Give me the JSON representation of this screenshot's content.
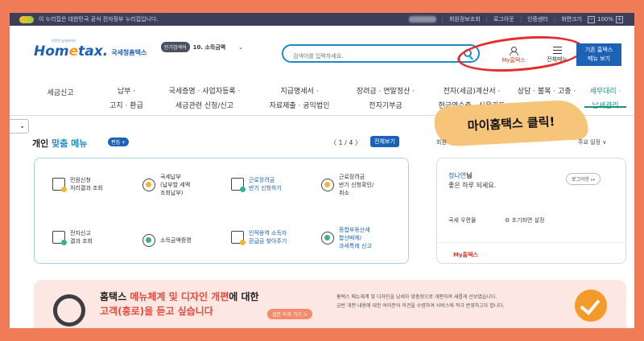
{
  "topbar": {
    "gov_notice": "이 누리집은 대한민국 공식 전자정부 누리집입니다.",
    "links": [
      "회원정보조회",
      "로그아웃",
      "인증센터",
      "화면크기"
    ],
    "zoom": "100%"
  },
  "header": {
    "logo_brand_a": "Hom",
    "logo_brand_b": "e",
    "logo_brand_c": "tax.",
    "logo_agency": "국세청홈택스",
    "logo_tag": "안전한 납세서비스",
    "popular_badge": "인기검색어",
    "popular_item": "10. 소득금액",
    "search_placeholder": "검색어를 입력하세요.",
    "my_hometax": "My홈택스",
    "all_menu": "전체메뉴",
    "site_menu_line1": "기존 홈택스",
    "site_menu_line2": "메뉴 보기"
  },
  "gnb": [
    {
      "l1": "세금신고",
      "l2": ""
    },
    {
      "l1": "납부 ·",
      "l2": "고지 · 환급"
    },
    {
      "l1": "국세증명 · 사업자등록 ·",
      "l2": "세금관련 신청/신고"
    },
    {
      "l1": "지급명세서 ·",
      "l2": "자료제출 · 공익법인"
    },
    {
      "l1": "장려금 · 연말정산 ·",
      "l2": "전자기부금"
    },
    {
      "l1": "전자(세금)계산서 ·",
      "l2": "현금영수증 · 신용카드"
    },
    {
      "l1": "상담 · 불복 · 고충 ·",
      "l2": "제보 · 기타"
    },
    {
      "l1": "세무대리 ·",
      "l2": "납세관리"
    }
  ],
  "callout": "마이홈택스 클릭!",
  "quick": {
    "title_a": "개인 ",
    "title_b": "맞춤 메뉴",
    "badge": "편집 +",
    "pager": "〈  1 / 4  〉",
    "all_view": "전체보기",
    "items": [
      {
        "l1": "민원신청",
        "l2": "처리결과 조회",
        "l3": ""
      },
      {
        "l1": "국세납부",
        "l2": "(납부할 세액",
        "l3": "조회납부)"
      },
      {
        "l1": "근로장려금",
        "l2": "반기 신청하기",
        "l3": ""
      },
      {
        "l1": "근로장려금",
        "l2": "반기 신청확인/",
        "l3": "취소"
      },
      {
        "l1": "전자신고",
        "l2": "결과 조회",
        "l3": ""
      },
      {
        "l1": "소득금액증명",
        "l2": "",
        "l3": ""
      },
      {
        "l1": "인적용역 소득자",
        "l2": "환급금 찾아주기",
        "l3": ""
      },
      {
        "l1": "종합부동산세",
        "l2": "합산배제/",
        "l3": "과세특례 신고"
      }
    ]
  },
  "right_head": "회원",
  "right_head2": "주요 일정 ∨",
  "user": {
    "name": "정나연",
    "name_suffix": "님",
    "greet": "좋은 하루 되세요.",
    "logout": "로그아웃 ↦",
    "mail": "국세 우편물",
    "reset": "초기화면 설정",
    "my": "My홈택스"
  },
  "banner": {
    "head_a": "홈택스 ",
    "head_b": "메뉴체계 및 디자인 개편",
    "head_c": "에 대한",
    "head_d": "고객(흥로)을 듣고 싶습니다",
    "button": "설문 바로 가기 >",
    "desc1": "홈택스 메뉴체계 및 디자인을 납세자 맞춤형으로 개편하여 새롭게 선보였습니다.",
    "desc2": "금번 개편 내용에 대한 여러분의 의견을 수렴하여 서비스에 적극 반영하고자 합니다."
  }
}
